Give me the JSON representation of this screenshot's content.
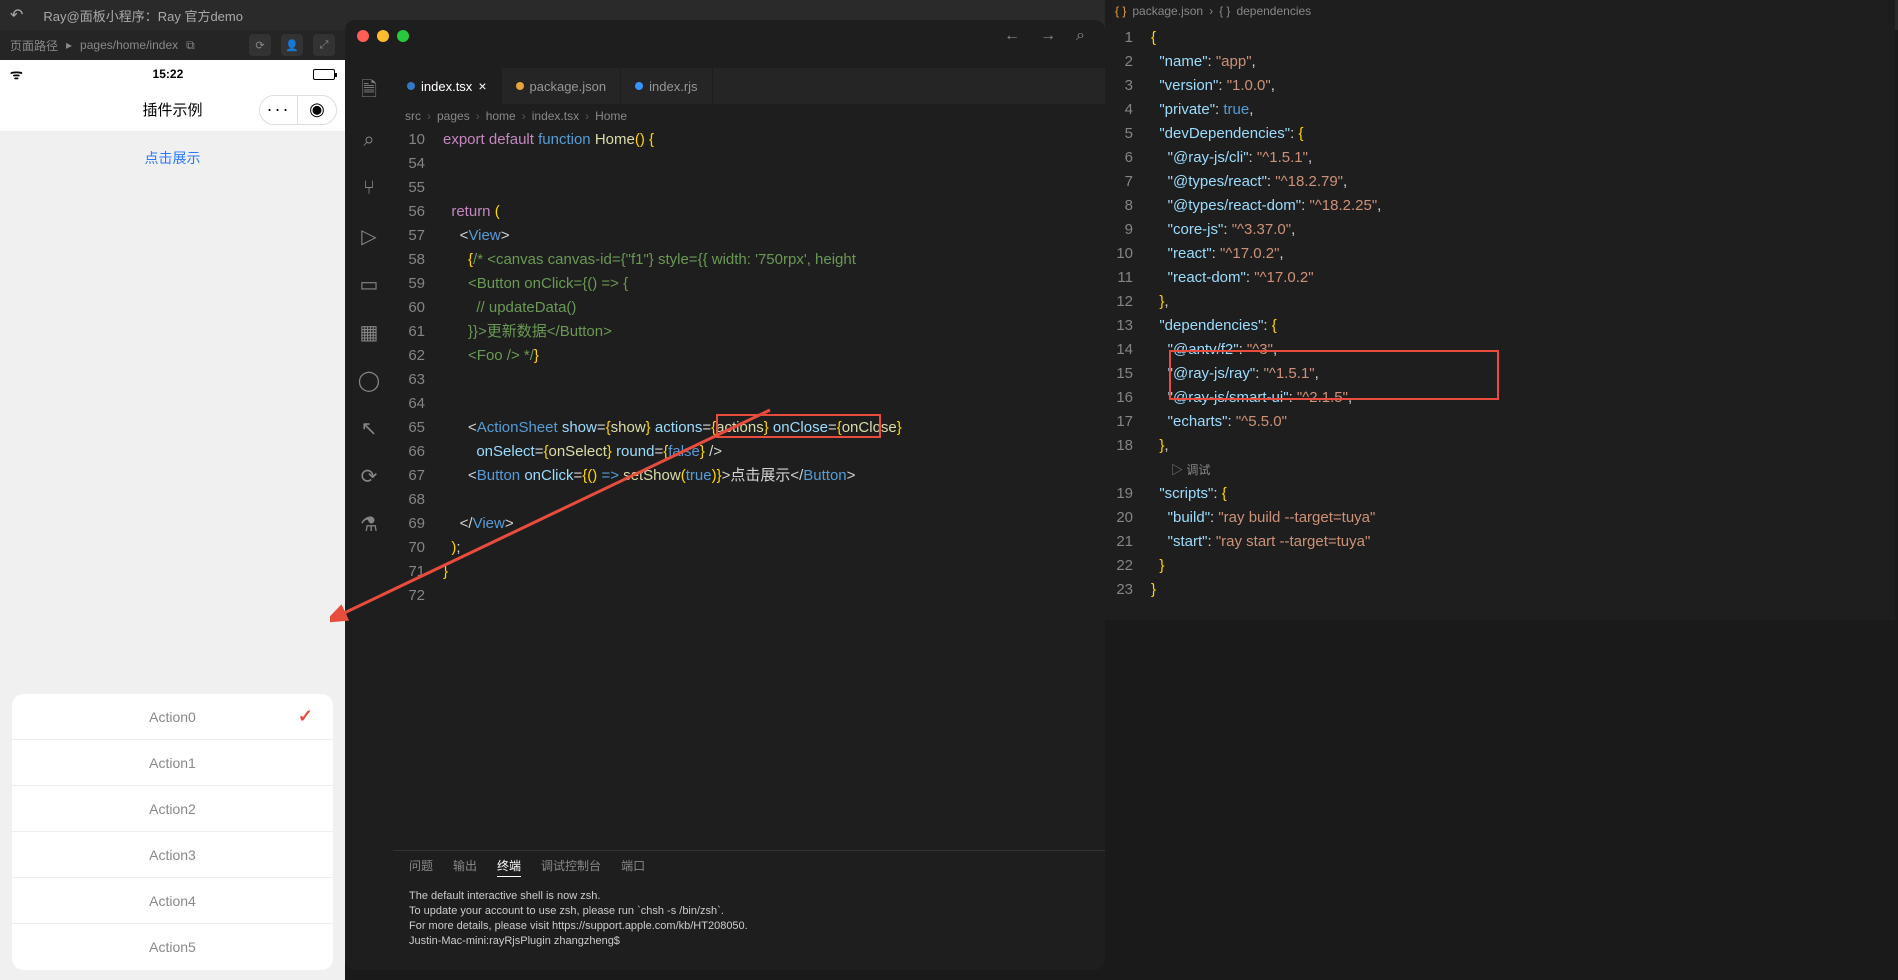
{
  "devbar": {
    "title": "Ray@面板小程序：Ray 官方demo"
  },
  "routebar": {
    "label": "页面路径",
    "path": "pages/home/index"
  },
  "simulator": {
    "time": "15:22",
    "headerTitle": "插件示例",
    "linkText": "点击展示",
    "actions": [
      "Action0",
      "Action1",
      "Action2",
      "Action3",
      "Action4",
      "Action5"
    ]
  },
  "vscode": {
    "tabs": [
      {
        "label": "index.tsx",
        "active": true
      },
      {
        "label": "package.json",
        "active": false
      },
      {
        "label": "index.rjs",
        "active": false
      }
    ],
    "breadcrumb": [
      "src",
      "pages",
      "home",
      "index.tsx",
      "Home"
    ],
    "code": [
      {
        "n": "10",
        "html": "<span class='kw'>export</span> <span class='kw'>default</span> <span class='fn'>function</span> <span class='id'>Home</span><span class='paren'>()</span> <span class='brace'>{</span>"
      },
      {
        "n": "54",
        "html": ""
      },
      {
        "n": "55",
        "html": ""
      },
      {
        "n": "56",
        "html": "  <span class='kw'>return</span> <span class='paren'>(</span>"
      },
      {
        "n": "57",
        "html": "    &lt;<span class='tag'>View</span>&gt;"
      },
      {
        "n": "58",
        "html": "      <span class='brace'>{</span><span class='comment'>/* &lt;canvas canvas-id={\"f1\"} style={{ width: '750rpx', height</span>"
      },
      {
        "n": "59",
        "html": "      <span class='comment'>&lt;Button onClick={() =&gt; {</span>"
      },
      {
        "n": "60",
        "html": "        <span class='comment'>// updateData()</span>"
      },
      {
        "n": "61",
        "html": "      <span class='comment'>}}&gt;更新数据&lt;/Button&gt;</span>"
      },
      {
        "n": "62",
        "html": "      <span class='comment'>&lt;Foo /&gt; */</span><span class='brace'>}</span>"
      },
      {
        "n": "63",
        "html": ""
      },
      {
        "n": "64",
        "html": ""
      },
      {
        "n": "65",
        "html": "      &lt;<span class='tag'>ActionSheet</span> <span class='attr'>show</span>=<span class='brace'>{</span><span class='id'>show</span><span class='brace'>}</span> <span class='attr'>actions</span>=<span class='brace'>{</span><span class='id'>actions</span><span class='brace'>}</span> <span class='attr'>onClose</span>=<span class='brace'>{</span><span class='id'>onClose</span><span class='brace'>}</span>"
      },
      {
        "n": "66",
        "html": "        <span class='attr'>onSelect</span>=<span class='brace'>{</span><span class='id'>onSelect</span><span class='brace'>}</span> <span class='attr'>round</span>=<span class='brace'>{</span><span class='val'>false</span><span class='brace'>}</span> /&gt;"
      },
      {
        "n": "67",
        "html": "      &lt;<span class='tag'>Button</span> <span class='attr'>onClick</span>=<span class='brace'>{</span><span class='paren'>()</span> <span class='fn'>=&gt;</span> <span class='id'>setShow</span><span class='paren'>(</span><span class='val'>true</span><span class='paren'>)</span><span class='brace'>}</span>&gt;点击展示&lt;/<span class='tag'>Button</span>&gt;"
      },
      {
        "n": "68",
        "html": ""
      },
      {
        "n": "69",
        "html": "    &lt;/<span class='tag'>View</span>&gt;"
      },
      {
        "n": "70",
        "html": "  <span class='paren'>)</span>;"
      },
      {
        "n": "71",
        "html": "<span class='brace'>}</span>"
      },
      {
        "n": "72",
        "html": ""
      }
    ],
    "terminal": {
      "tabs": [
        "问题",
        "输出",
        "终端",
        "调试控制台",
        "端口"
      ],
      "activeTab": 2,
      "lines": [
        "The default interactive shell is now zsh.",
        "To update your account to use zsh, please run `chsh -s /bin/zsh`.",
        "For more details, please visit https://support.apple.com/kb/HT208050.",
        "Justin-Mac-mini:rayRjsPlugin zhangzheng$"
      ]
    }
  },
  "rightPane": {
    "crumb": [
      "package.json",
      "dependencies"
    ],
    "debugLabel": "▷ 调试",
    "code": [
      {
        "n": "1",
        "html": "<span class='brace'>{</span>"
      },
      {
        "n": "2",
        "html": "  <span class='key'>\"name\"</span>: <span class='jstr'>\"app\"</span>,"
      },
      {
        "n": "3",
        "html": "  <span class='key'>\"version\"</span>: <span class='jstr'>\"1.0.0\"</span>,"
      },
      {
        "n": "4",
        "html": "  <span class='key'>\"private\"</span>: <span class='jval'>true</span>,"
      },
      {
        "n": "5",
        "html": "  <span class='key'>\"devDependencies\"</span>: <span class='brace'>{</span>"
      },
      {
        "n": "6",
        "html": "    <span class='key'>\"@ray-js/cli\"</span>: <span class='jstr'>\"^1.5.1\"</span>,"
      },
      {
        "n": "7",
        "html": "    <span class='key'>\"@types/react\"</span>: <span class='jstr'>\"^18.2.79\"</span>,"
      },
      {
        "n": "8",
        "html": "    <span class='key'>\"@types/react-dom\"</span>: <span class='jstr'>\"^18.2.25\"</span>,"
      },
      {
        "n": "9",
        "html": "    <span class='key'>\"core-js\"</span>: <span class='jstr'>\"^3.37.0\"</span>,"
      },
      {
        "n": "10",
        "html": "    <span class='key'>\"react\"</span>: <span class='jstr'>\"^17.0.2\"</span>,"
      },
      {
        "n": "11",
        "html": "    <span class='key'>\"react-dom\"</span>: <span class='jstr'>\"^17.0.2\"</span>"
      },
      {
        "n": "12",
        "html": "  <span class='brace'>}</span>,"
      },
      {
        "n": "13",
        "html": "  <span class='key'>\"dependencies\"</span>: <span class='brace'>{</span>"
      },
      {
        "n": "14",
        "html": "    <span class='key'>\"@antv/f2\"</span>: <span class='jstr'>\"^3\"</span>,"
      },
      {
        "n": "15",
        "html": "    <span class='key'>\"@ray-js/ray\"</span>: <span class='jstr'>\"^1.5.1\"</span>,"
      },
      {
        "n": "16",
        "html": "    <span class='key'>\"@ray-js/smart-ui\"</span>: <span class='jstr'>\"^2.1.5\"</span>,"
      },
      {
        "n": "17",
        "html": "    <span class='key'>\"echarts\"</span>: <span class='jstr'>\"^5.5.0\"</span>"
      },
      {
        "n": "18",
        "html": "  <span class='brace'>}</span>,"
      },
      {
        "n": "19",
        "html": "  <span class='key'>\"scripts\"</span>: <span class='brace'>{</span>"
      },
      {
        "n": "20",
        "html": "    <span class='key'>\"build\"</span>: <span class='jstr'>\"ray build --target=tuya\"</span>"
      },
      {
        "n": "21",
        "html": "    <span class='key'>\"start\"</span>: <span class='jstr'>\"ray start --target=tuya\"</span>"
      },
      {
        "n": "22",
        "html": "  <span class='brace'>}</span>"
      },
      {
        "n": "23",
        "html": "<span class='brace'>}</span>"
      }
    ]
  }
}
